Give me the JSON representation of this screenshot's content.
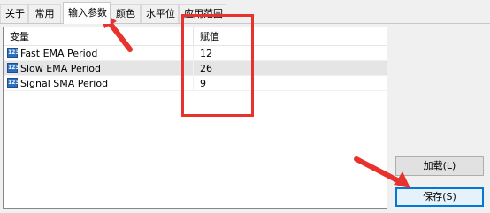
{
  "tabs": [
    {
      "label": "关于"
    },
    {
      "label": "常用"
    },
    {
      "label": "输入参数"
    },
    {
      "label": "颜色"
    },
    {
      "label": "水平位"
    },
    {
      "label": "应用范围"
    }
  ],
  "table": {
    "col_variable": "变量",
    "col_value": "赋值",
    "rows": [
      {
        "icon": "123",
        "name": "Fast EMA Period",
        "value": "12"
      },
      {
        "icon": "123",
        "name": "Slow EMA Period",
        "value": "26"
      },
      {
        "icon": "123",
        "name": "Signal SMA Period",
        "value": "9"
      }
    ]
  },
  "buttons": {
    "load": "加载(L)",
    "save": "保存(S)"
  },
  "colors": {
    "annotation": "#e8322d",
    "selection": "#e5e5e5",
    "default_button": "#0078d7"
  }
}
